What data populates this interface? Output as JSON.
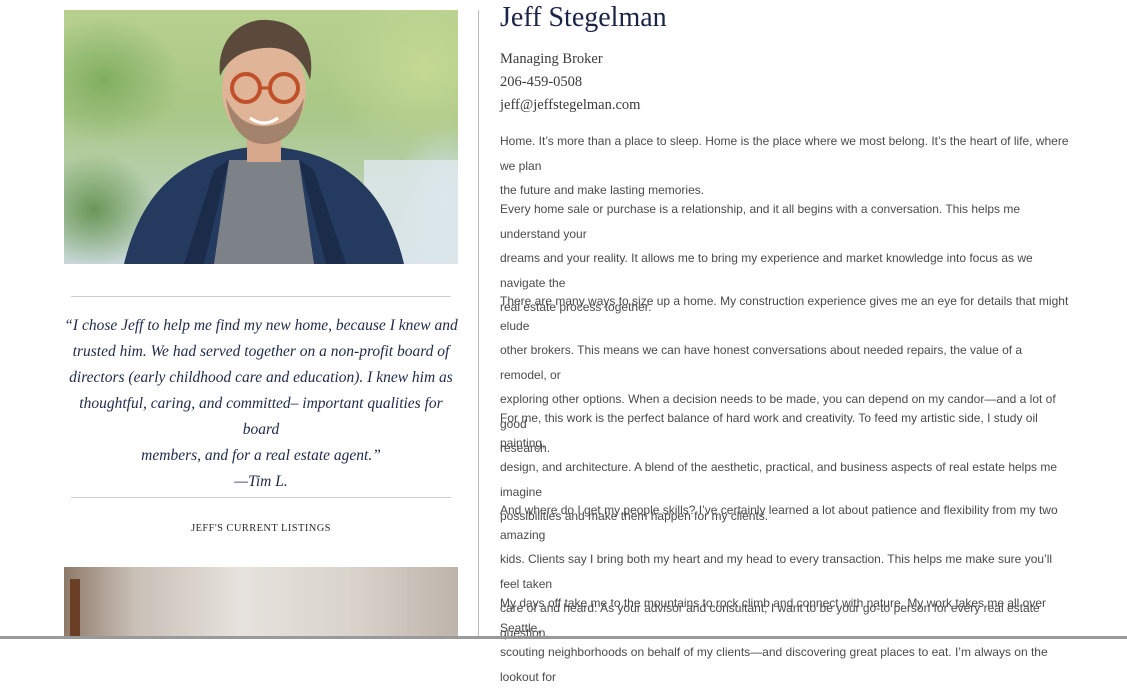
{
  "agent": {
    "name": "Jeff Stegelman",
    "title": "Managing Broker",
    "phone": "206-459-0508",
    "email": "jeff@jeffstegelman.com"
  },
  "testimonial": {
    "lines": [
      "“I chose Jeff to help me find my new home, because I knew and",
      "trusted him. We had served together on a non-profit board of",
      "directors (early childhood care and education). I knew him as",
      "thoughtful, caring, and committed– important qualities for board",
      "members, and for a real estate agent.”"
    ],
    "author": "—Tim L."
  },
  "listings": {
    "heading": "JEFF'S CURRENT LISTINGS"
  },
  "bio": [
    {
      "lines": [
        "Home. It’s more than a place to sleep. Home is the place where we most belong. It’s the heart of life, where we plan",
        "the future and make lasting memories."
      ]
    },
    {
      "lines": [
        "Every home sale or purchase is a relationship, and it all begins with a conversation. This helps me understand your",
        "dreams and your reality. It allows me to bring my experience and market knowledge into focus as we navigate the",
        "real estate process together."
      ]
    },
    {
      "lines": [
        "There are many ways to size up a home. My construction experience gives me an eye for details that might elude",
        "other brokers. This means we can have honest conversations about needed repairs, the value of a remodel, or",
        "exploring other options. When a decision needs to be made, you can depend on my candor—and a lot of good",
        "research."
      ]
    },
    {
      "lines": [
        "For me, this work is the perfect balance of hard work and creativity. To feed my artistic side, I study oil painting,",
        "design, and architecture. A blend of the aesthetic, practical, and business aspects of real estate helps me imagine",
        "possibilities and make them happen for my clients."
      ]
    },
    {
      "lines": [
        "And where do I get my people skills? I’ve certainly learned a lot about patience and flexibility from my two amazing",
        "kids. Clients say I bring both my heart and my head to every transaction. This helps me make sure you’ll feel taken",
        "care of and heard. As your advisor and consultant, I want to be your go-to person for every real estate question."
      ]
    },
    {
      "lines": [
        "My days off take me to the mountains to rock climb and connect with nature. My work takes me all over Seattle,",
        "scouting neighborhoods on behalf of my clients—and discovering great places to eat. I’m always on the lookout for"
      ]
    }
  ],
  "colors": {
    "name": "#1b2447",
    "quote": "#1f2a4a",
    "body_text": "#4a4a4a",
    "divider": "#bdbdbd"
  }
}
